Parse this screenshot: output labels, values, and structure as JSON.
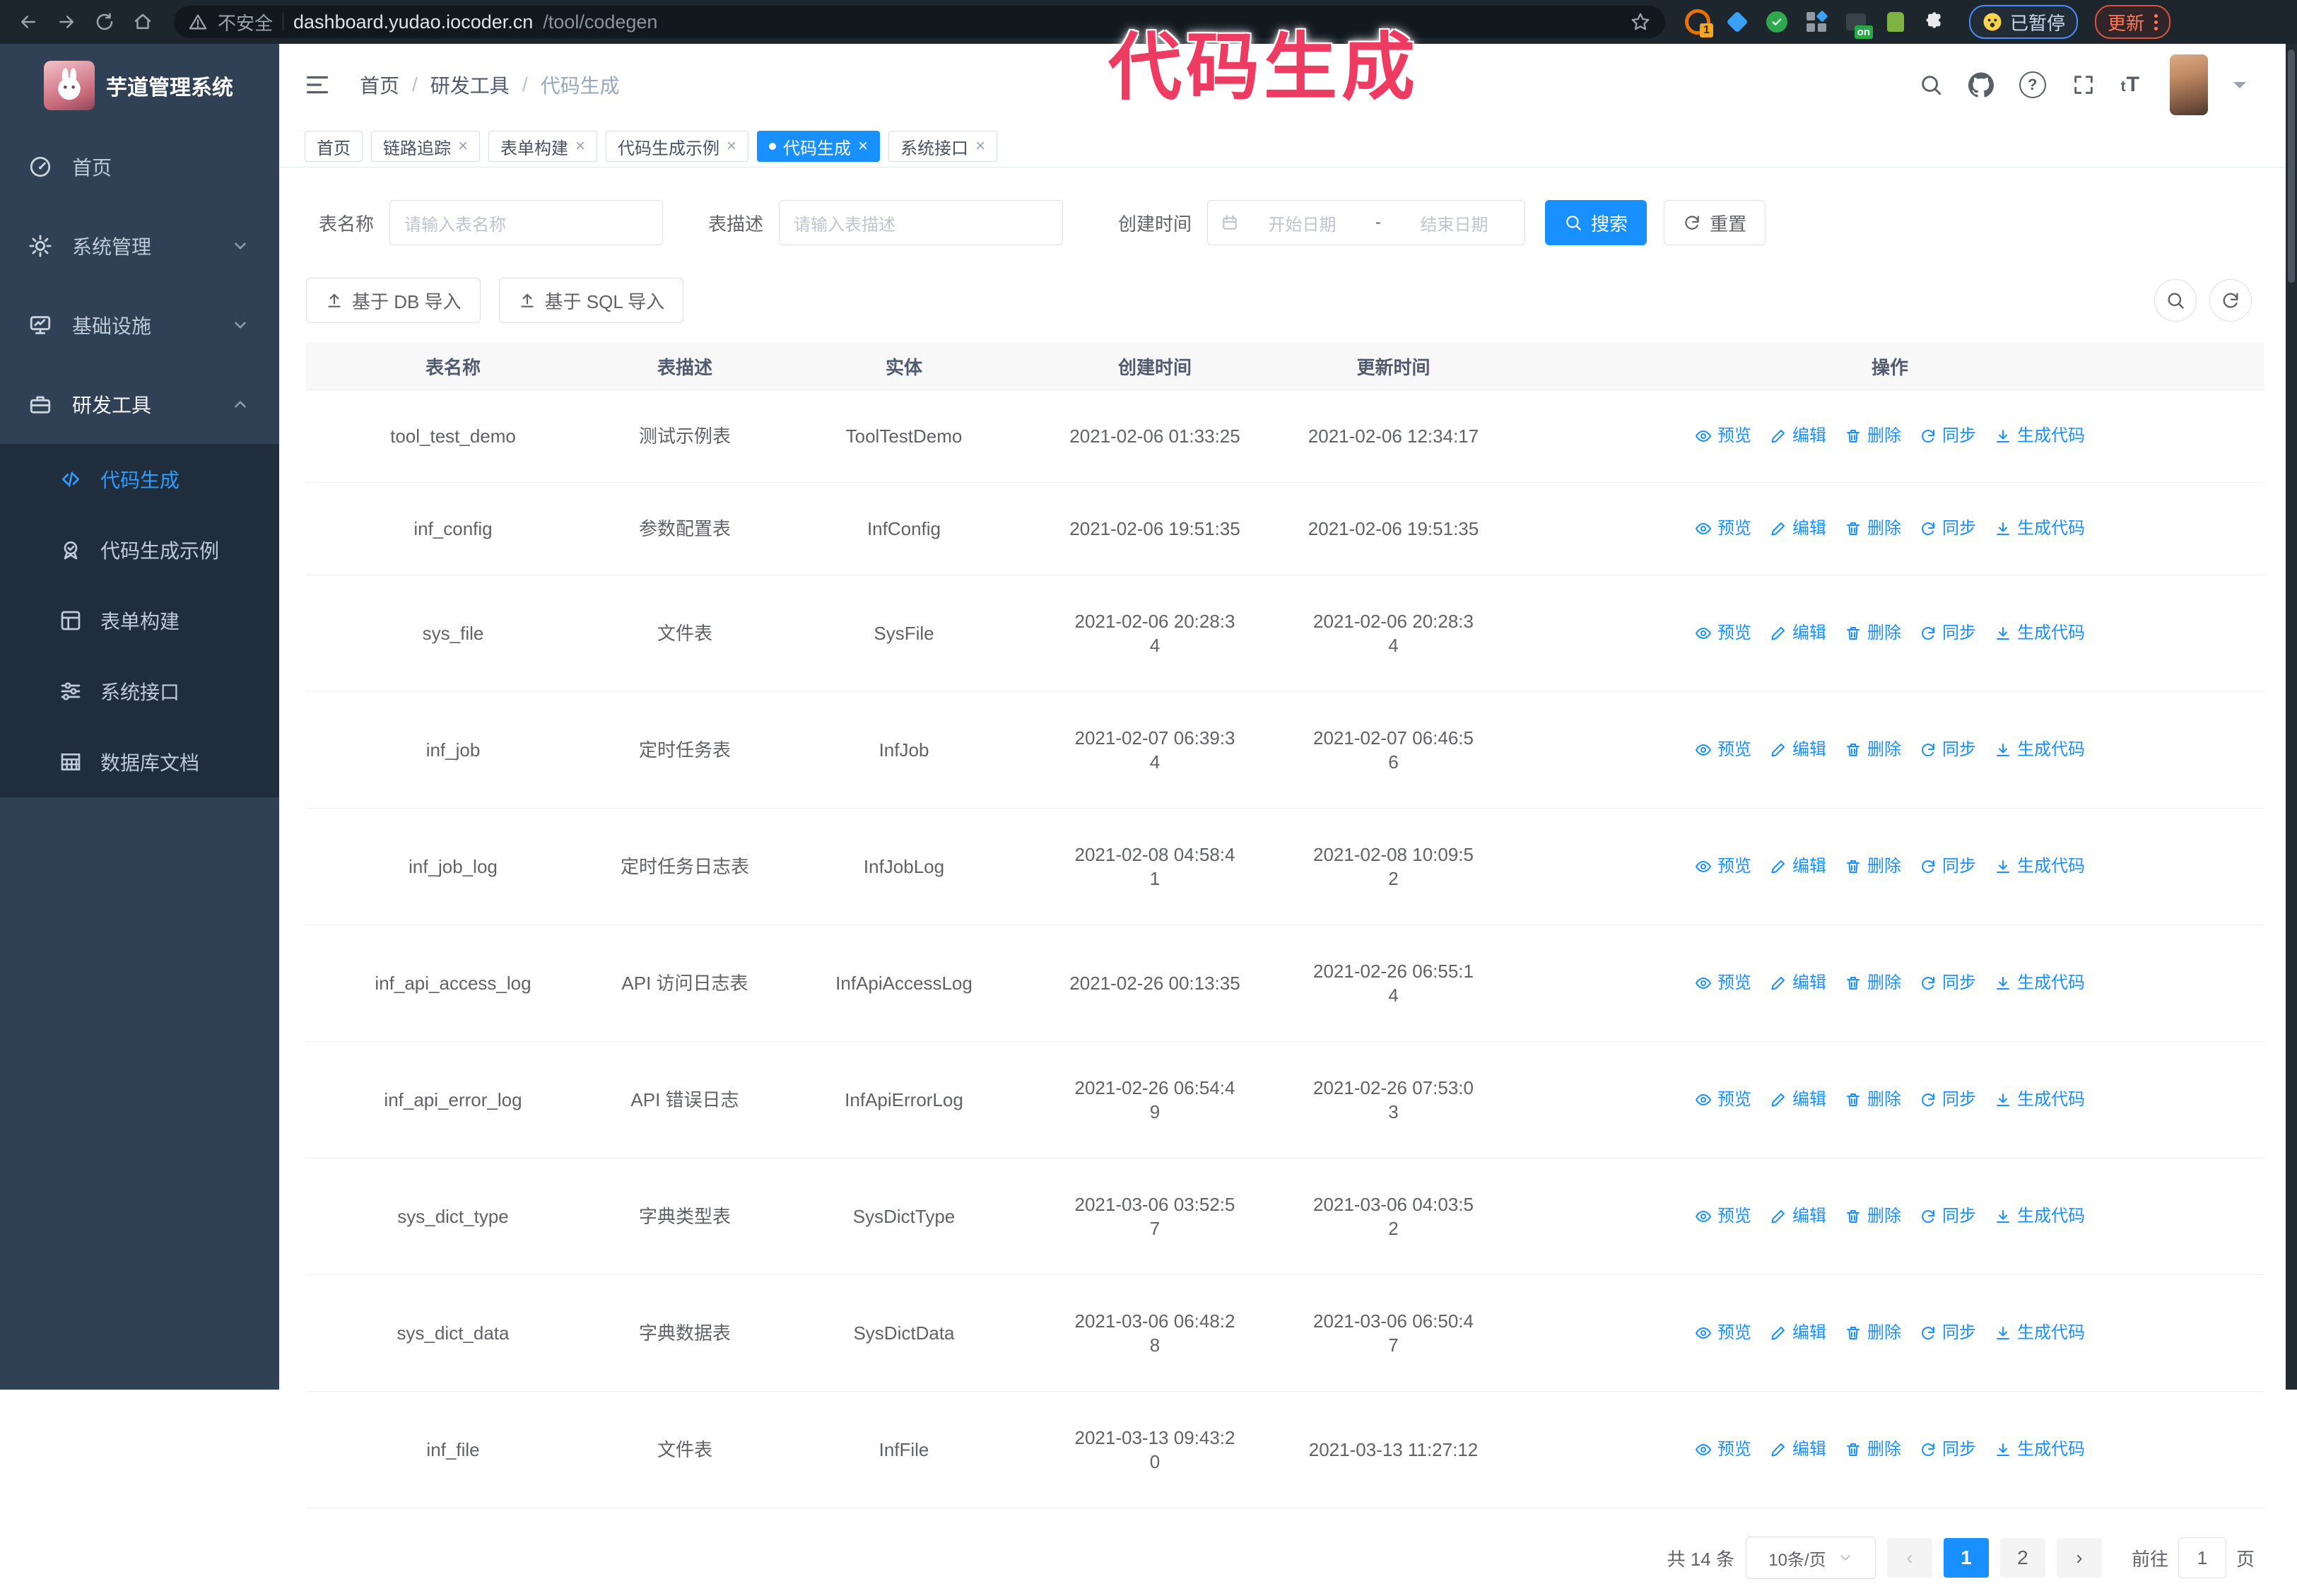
{
  "colors": {
    "accent": "#1890ff",
    "annotation": "#ee3b62",
    "sidebar_bg": "#304156",
    "submenu_bg": "#1f2d3d",
    "chrome_bg": "#1d252d"
  },
  "browser": {
    "security_label": "不安全",
    "url_host": "dashboard.yudao.iocoder.cn",
    "url_path": "/tool/codegen",
    "ext_badge": "1",
    "ext_on": "on",
    "paused_label": "已暂停",
    "update_label": "更新"
  },
  "annotation": {
    "text": "代码生成"
  },
  "sidebar": {
    "logo_title": "芋道管理系统",
    "items": [
      {
        "label": "首页",
        "icon": "dashboard-icon"
      },
      {
        "label": "系统管理",
        "icon": "gear-icon"
      },
      {
        "label": "基础设施",
        "icon": "monitor-icon"
      },
      {
        "label": "研发工具",
        "icon": "toolbox-icon"
      }
    ],
    "submenu": [
      {
        "label": "代码生成",
        "icon": "code-icon",
        "active": true
      },
      {
        "label": "代码生成示例",
        "icon": "seal-check-icon"
      },
      {
        "label": "表单构建",
        "icon": "form-icon"
      },
      {
        "label": "系统接口",
        "icon": "sliders-icon"
      },
      {
        "label": "数据库文档",
        "icon": "database-icon"
      }
    ]
  },
  "header": {
    "breadcrumb": [
      "首页",
      "研发工具",
      "代码生成"
    ],
    "breadcrumb_separator": "/",
    "font_size_icon": "tT"
  },
  "tabs": [
    {
      "label": "首页",
      "closable": false,
      "active": false
    },
    {
      "label": "链路追踪",
      "closable": true,
      "active": false
    },
    {
      "label": "表单构建",
      "closable": true,
      "active": false
    },
    {
      "label": "代码生成示例",
      "closable": true,
      "active": false
    },
    {
      "label": "代码生成",
      "closable": true,
      "active": true
    },
    {
      "label": "系统接口",
      "closable": true,
      "active": false
    }
  ],
  "filters": {
    "table_name_label": "表名称",
    "table_name_placeholder": "请输入表名称",
    "table_desc_label": "表描述",
    "table_desc_placeholder": "请输入表描述",
    "create_time_label": "创建时间",
    "date_start_placeholder": "开始日期",
    "date_separator": "-",
    "date_end_placeholder": "结束日期",
    "search_button": "搜索",
    "reset_button": "重置"
  },
  "toolbar": {
    "import_db": "基于 DB 导入",
    "import_sql": "基于 SQL 导入"
  },
  "table": {
    "columns": [
      "表名称",
      "表描述",
      "实体",
      "创建时间",
      "更新时间",
      "操作"
    ],
    "actions": [
      "预览",
      "编辑",
      "删除",
      "同步",
      "生成代码"
    ],
    "rows": [
      {
        "name": "tool_test_demo",
        "desc": "测试示例表",
        "entity": "ToolTestDemo",
        "created": "2021-02-06 01:33:25",
        "updated": "2021-02-06 12:34:17"
      },
      {
        "name": "inf_config",
        "desc": "参数配置表",
        "entity": "InfConfig",
        "created": "2021-02-06 19:51:35",
        "updated": "2021-02-06 19:51:35"
      },
      {
        "name": "sys_file",
        "desc": "文件表",
        "entity": "SysFile",
        "created": "2021-02-06 20:28:3\n4",
        "updated": "2021-02-06 20:28:3\n4"
      },
      {
        "name": "inf_job",
        "desc": "定时任务表",
        "entity": "InfJob",
        "created": "2021-02-07 06:39:3\n4",
        "updated": "2021-02-07 06:46:5\n6"
      },
      {
        "name": "inf_job_log",
        "desc": "定时任务日志表",
        "entity": "InfJobLog",
        "created": "2021-02-08 04:58:4\n1",
        "updated": "2021-02-08 10:09:5\n2"
      },
      {
        "name": "inf_api_access_log",
        "desc": "API 访问日志表",
        "entity": "InfApiAccessLog",
        "created": "2021-02-26 00:13:35",
        "updated": "2021-02-26 06:55:1\n4"
      },
      {
        "name": "inf_api_error_log",
        "desc": "API 错误日志",
        "entity": "InfApiErrorLog",
        "created": "2021-02-26 06:54:4\n9",
        "updated": "2021-02-26 07:53:0\n3"
      },
      {
        "name": "sys_dict_type",
        "desc": "字典类型表",
        "entity": "SysDictType",
        "created": "2021-03-06 03:52:5\n7",
        "updated": "2021-03-06 04:03:5\n2"
      },
      {
        "name": "sys_dict_data",
        "desc": "字典数据表",
        "entity": "SysDictData",
        "created": "2021-03-06 06:48:2\n8",
        "updated": "2021-03-06 06:50:4\n7"
      },
      {
        "name": "inf_file",
        "desc": "文件表",
        "entity": "InfFile",
        "created": "2021-03-13 09:43:2\n0",
        "updated": "2021-03-13 11:27:12"
      }
    ]
  },
  "pagination": {
    "total": "共 14 条",
    "page_size": "10条/页",
    "pages": [
      "1",
      "2"
    ],
    "active_page": "1",
    "goto_label": "前往",
    "goto_value": "1",
    "page_suffix": "页"
  }
}
